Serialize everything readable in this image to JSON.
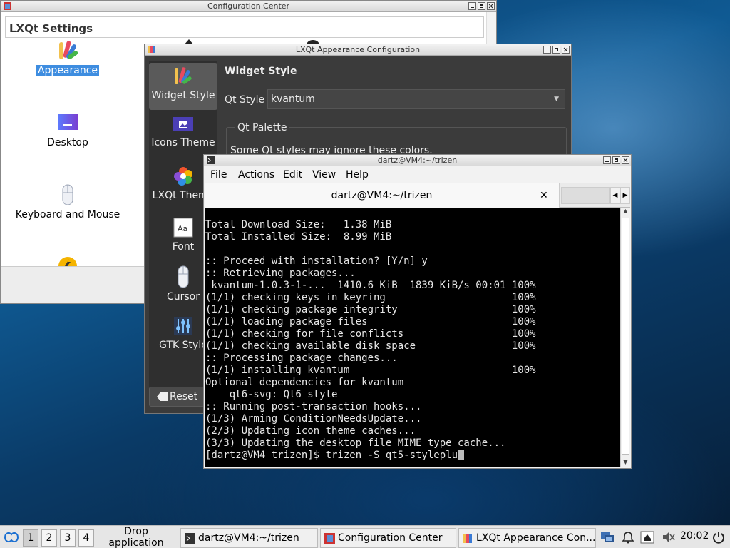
{
  "config_center": {
    "title": "Configuration Center",
    "section": "LXQt Settings",
    "items": [
      {
        "label": "Appearance",
        "icon": "appearance-icon"
      },
      {
        "label": "Desktop",
        "icon": "desktop-icon"
      },
      {
        "label": "Keyboard and Mouse",
        "icon": "mouse-icon"
      }
    ]
  },
  "appearance": {
    "title": "LXQt Appearance Configuration",
    "sidebar": [
      {
        "label": "Widget Style",
        "icon": "widget-style-icon"
      },
      {
        "label": "Icons Theme",
        "icon": "icons-theme-icon"
      },
      {
        "label": "LXQt Theme",
        "icon": "lxqt-theme-icon"
      },
      {
        "label": "Font",
        "icon": "font-icon"
      },
      {
        "label": "Cursor",
        "icon": "cursor-icon"
      },
      {
        "label": "GTK Style",
        "icon": "gtk-style-icon"
      }
    ],
    "heading": "Widget Style",
    "qt_style_label": "Qt Style",
    "qt_style_value": "kvantum",
    "palette_title": "Qt Palette",
    "palette_note": "Some Qt styles may ignore these colors.",
    "reset_label": "Reset"
  },
  "terminal": {
    "title": "dartz@VM4:~/trizen",
    "menu": [
      "File",
      "Actions",
      "Edit",
      "View",
      "Help"
    ],
    "tab_title": "dartz@VM4:~/trizen",
    "tab_close": "✕",
    "lines": [
      "Total Download Size:   1.38 MiB",
      "Total Installed Size:  8.99 MiB",
      "",
      ":: Proceed with installation? [Y/n] y",
      ":: Retrieving packages...",
      " kvantum-1.0.3-1-...  1410.6 KiB  1839 KiB/s 00:01 100%",
      "(1/1) checking keys in keyring                     100%",
      "(1/1) checking package integrity                   100%",
      "(1/1) loading package files                        100%",
      "(1/1) checking for file conflicts                  100%",
      "(1/1) checking available disk space                100%",
      ":: Processing package changes...",
      "(1/1) installing kvantum                           100%",
      "Optional dependencies for kvantum",
      "    qt6-svg: Qt6 style",
      ":: Running post-transaction hooks...",
      "(1/3) Arming ConditionNeedsUpdate...",
      "(2/3) Updating icon theme caches...",
      "(3/3) Updating the desktop file MIME type cache..."
    ],
    "prompt": "[dartz@VM4 trizen]$ trizen -S qt5-styleplu"
  },
  "taskbar": {
    "workspaces": [
      "1",
      "2",
      "3",
      "4"
    ],
    "drop_hint": "Drop application icons here",
    "tasks": [
      {
        "label": "dartz@VM4:~/trizen",
        "icon": "terminal-icon"
      },
      {
        "label": "Configuration Center",
        "icon": "config-center-icon"
      },
      {
        "label": "LXQt Appearance Con...",
        "icon": "appearance-icon"
      }
    ],
    "clock": "20:02"
  }
}
